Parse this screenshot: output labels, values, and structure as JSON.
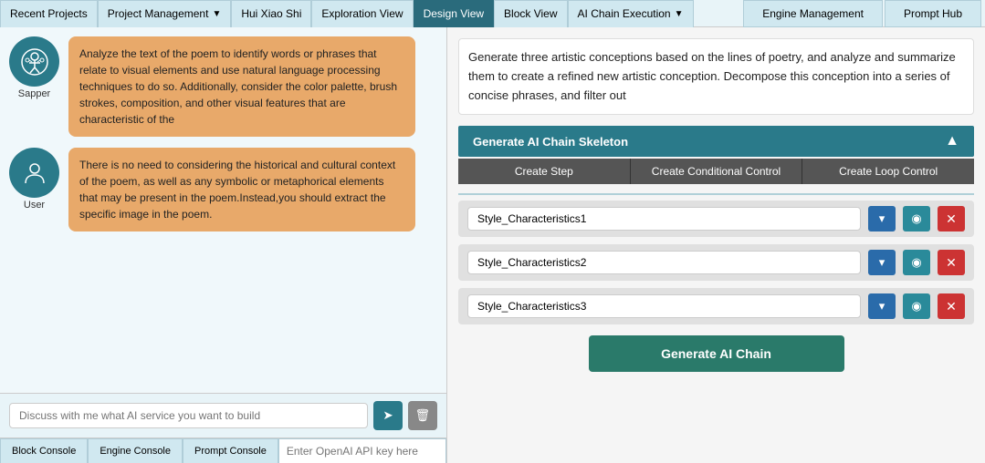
{
  "nav": {
    "tabs": [
      {
        "id": "recent-projects",
        "label": "Recent Projects",
        "arrow": false,
        "active": false
      },
      {
        "id": "project-management",
        "label": "Project Management",
        "arrow": true,
        "active": false
      },
      {
        "id": "hui-xiao-shi",
        "label": "Hui Xiao Shi",
        "arrow": false,
        "active": false
      },
      {
        "id": "exploration-view",
        "label": "Exploration View",
        "arrow": false,
        "active": false
      },
      {
        "id": "design-view",
        "label": "Design View",
        "arrow": false,
        "active": true
      },
      {
        "id": "block-view",
        "label": "Block View",
        "arrow": false,
        "active": false
      },
      {
        "id": "ai-chain-execution",
        "label": "AI Chain Execution",
        "arrow": true,
        "active": false
      }
    ],
    "right_tabs": [
      {
        "id": "engine-management",
        "label": "Engine Management"
      },
      {
        "id": "prompt-hub",
        "label": "Prompt Hub"
      }
    ]
  },
  "chat": {
    "messages": [
      {
        "avatar_type": "sapper",
        "label": "Sapper",
        "text": "Analyze the text of the poem to identify words or phrases that relate to visual elements and use natural language processing techniques to do so. Additionally, consider the color palette, brush strokes, composition, and other visual features that are characteristic of the"
      },
      {
        "avatar_type": "user",
        "label": "User",
        "text": "There is no need to considering the historical and cultural context of the poem, as well as any symbolic or metaphorical elements that may be present in the poem.Instead,you should extract the specific image in the poem."
      }
    ],
    "input_placeholder": "Discuss with me what AI service you want to build"
  },
  "console": {
    "tabs": [
      {
        "label": "Block Console"
      },
      {
        "label": "Engine Console"
      },
      {
        "label": "Prompt Console"
      }
    ],
    "api_key_placeholder": "Enter OpenAI API key here"
  },
  "right": {
    "description": "Generate three artistic conceptions based on the lines of poetry, and analyze and summarize them to create a refined new artistic conception. Decompose this conception into a series of concise phrases, and filter out",
    "skeleton_title": "Generate AI Chain Skeleton",
    "step_buttons": [
      "Create Step",
      "Create Conditional Control",
      "Create Loop Control"
    ],
    "steps": [
      {
        "id": "step1",
        "value": "Style_Characteristics1"
      },
      {
        "id": "step2",
        "value": "Style_Characteristics2"
      },
      {
        "id": "step3",
        "value": "Style_Characteristics3"
      }
    ],
    "generate_btn_label": "Generate AI Chain"
  },
  "icons": {
    "chevron_down": "▼",
    "chevron_up": "▲",
    "send": "➤",
    "trash": "🗑",
    "eye": "👁",
    "x": "✕",
    "arrow_down": "▾"
  }
}
